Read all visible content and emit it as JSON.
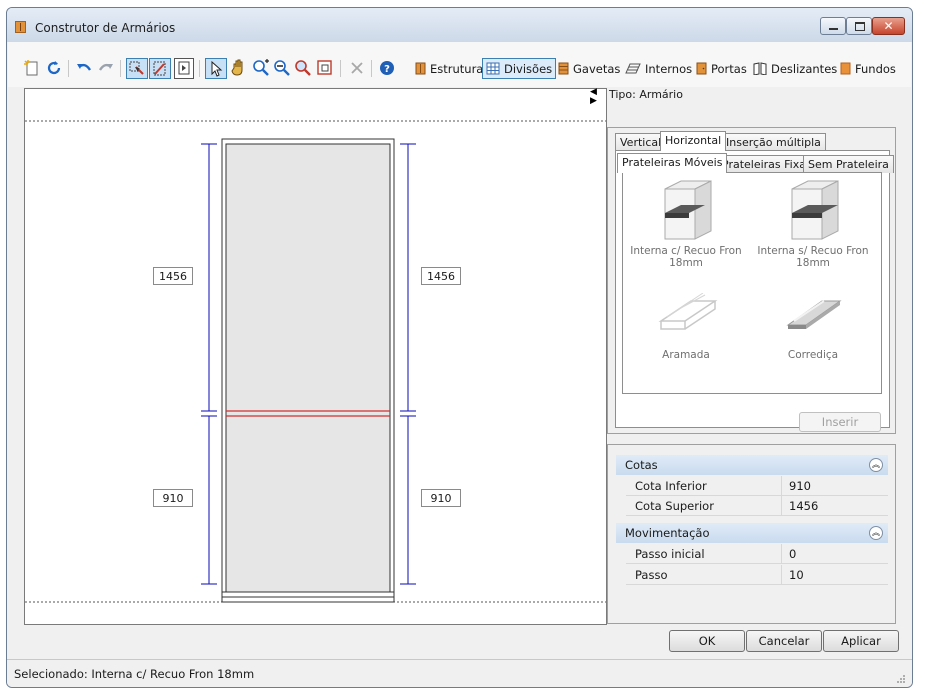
{
  "window": {
    "title": "Construtor de Armários"
  },
  "toolbar": {
    "categories": [
      {
        "label": "Estrutura",
        "pressed": false
      },
      {
        "label": "Divisões",
        "pressed": true
      },
      {
        "label": "Gavetas",
        "pressed": false
      },
      {
        "label": "Internos",
        "pressed": false
      },
      {
        "label": "Portas",
        "pressed": false
      },
      {
        "label": "Deslizantes",
        "pressed": false
      },
      {
        "label": "Fundos",
        "pressed": false
      }
    ]
  },
  "canvas": {
    "dimensions": {
      "top_left": "1456",
      "top_right": "1456",
      "bottom_left": "910",
      "bottom_right": "910"
    }
  },
  "right_panel": {
    "tipo_label": "Tipo: Armário",
    "tabs": [
      "Vertical",
      "Horizontal",
      "Inserção múltipla"
    ],
    "subtabs": [
      "Prateleiras Móveis",
      "Prateleiras Fixas",
      "Sem Prateleira"
    ],
    "items": [
      {
        "label": "Interna c/ Recuo Fron 18mm"
      },
      {
        "label": "Interna s/ Recuo Fron 18mm"
      },
      {
        "label": "Aramada"
      },
      {
        "label": "Corrediça"
      }
    ],
    "insert_button": "Inserir"
  },
  "properties": {
    "cotas": {
      "title": "Cotas",
      "rows": [
        {
          "name": "Cota Inferior",
          "value": "910"
        },
        {
          "name": "Cota Superior",
          "value": "1456"
        }
      ]
    },
    "movimentacao": {
      "title": "Movimentação",
      "rows": [
        {
          "name": "Passo inicial",
          "value": "0"
        },
        {
          "name": "Passo",
          "value": "10"
        }
      ]
    }
  },
  "buttons": {
    "ok": "OK",
    "cancel": "Cancelar",
    "apply": "Aplicar"
  },
  "status": {
    "text": "Selecionado: Interna c/ Recuo Fron 18mm"
  },
  "colors": {
    "accent": "#3c7fb1",
    "dimension_line": "#1f1fb8",
    "selected_shelf": "#d32f2f"
  }
}
